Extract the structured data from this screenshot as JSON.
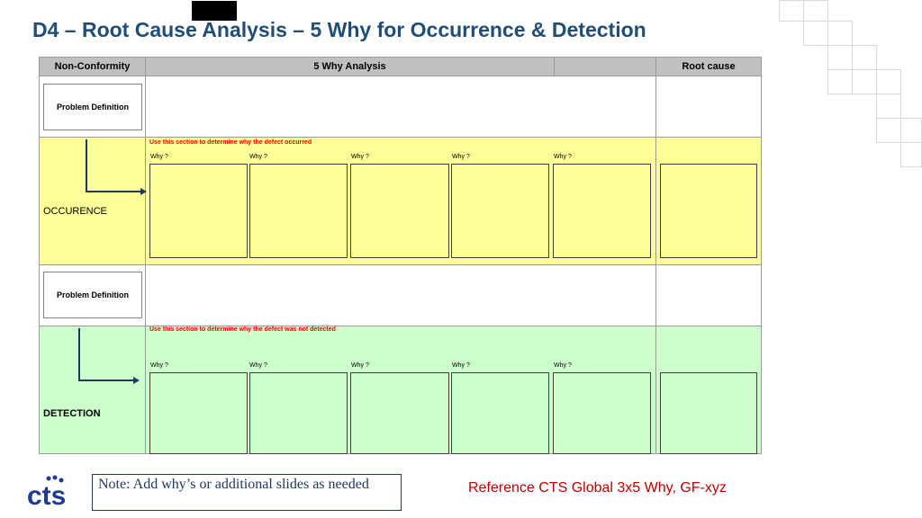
{
  "title": "D4 – Root Cause Analysis – 5 Why for Occurrence & Detection",
  "table": {
    "headers": {
      "non_conformity": "Non-Conformity",
      "five_why": "5 Why Analysis",
      "root_cause": "Root cause"
    },
    "occurrence": {
      "problem_definition": "Problem Definition",
      "instruction": "Use this section to determine why the defect occurred",
      "label": "OCCURENCE",
      "why_labels": [
        "Why ?",
        "Why ?",
        "Why ?",
        "Why ?",
        "Why ?"
      ]
    },
    "detection": {
      "problem_definition": "Problem Definition",
      "instruction": "Use this section to determine why the defect was not detected",
      "label": "DETECTION",
      "why_labels": [
        "Why ?",
        "Why ?",
        "Why ?",
        "Why ?",
        "Why ?"
      ]
    }
  },
  "note": "Note:  Add why’s or additional slides as needed",
  "reference": "Reference CTS Global 3x5 Why, GF-xyz",
  "logo": {
    "text": "cts",
    "color": "#1f3a93"
  },
  "colors": {
    "title": "#1f4e79",
    "occurrence_bg": "#ffff99",
    "detection_bg": "#ccffcc",
    "header_bg": "#c0c0c0",
    "instruction": "#ff0000",
    "arrow": "#1f3864"
  }
}
